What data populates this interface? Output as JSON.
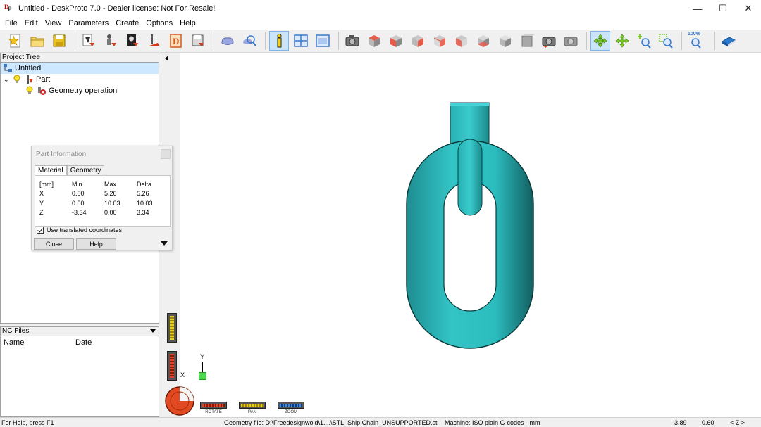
{
  "window": {
    "title": "Untitled - DeskProto 7.0 - Dealer license: Not For Resale!",
    "minimize": "—",
    "maximize": "☐",
    "close": "✕"
  },
  "menu": [
    "File",
    "Edit",
    "View",
    "Parameters",
    "Create",
    "Options",
    "Help"
  ],
  "toolbar": {
    "zoom_label": "100%"
  },
  "project_tree": {
    "header": "Project Tree",
    "root": "Untitled",
    "part": "Part",
    "operation": "Geometry operation"
  },
  "part_info": {
    "title": "Part Information",
    "tabs": [
      "Material",
      "Geometry"
    ],
    "headers": [
      "[mm]",
      "Min",
      "Max",
      "Delta"
    ],
    "rows": [
      [
        "X",
        "0.00",
        "5.26",
        "5.26"
      ],
      [
        "Y",
        "0.00",
        "10.03",
        "10.03"
      ],
      [
        "Z",
        "-3.34",
        "0.00",
        "3.34"
      ]
    ],
    "checkbox_label": "Use translated coordinates",
    "close_button": "Close",
    "help_button": "Help"
  },
  "nc_files": {
    "header": "NC Files",
    "columns": [
      "Name",
      "Date"
    ]
  },
  "viewport": {
    "axis_y": "Y",
    "axis_x": "X",
    "rotate_label": "ROTATE",
    "pan_label": "PAN",
    "zoom_label": "ZOOM",
    "model_color": "#2bbcbe"
  },
  "status": {
    "help": "For Help, press F1",
    "geometry": "Geometry file: D:\\Freedesignwold\\1....\\STL_Ship Chain_UNSUPPORTED.stl",
    "machine": "Machine: ISO plain G-codes - mm",
    "coord1": "-3.89",
    "coord2": "0.60",
    "axis": "< Z >"
  }
}
